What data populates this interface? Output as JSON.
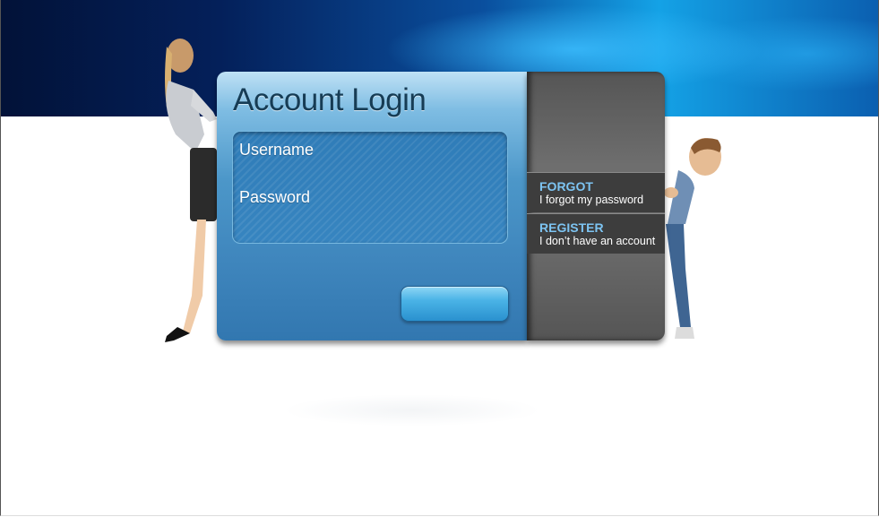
{
  "login": {
    "title": "Account Login",
    "username_label": "Username",
    "password_label": "Password"
  },
  "side_links": {
    "forgot": {
      "title": "FORGOT",
      "subtitle": "I forgot my password"
    },
    "register": {
      "title": "REGISTER",
      "subtitle": "I don’t have an account"
    }
  },
  "colors": {
    "banner_dark": "#021238",
    "banner_light": "#14a2e6",
    "card_blue": "#3f86bd",
    "side_gray": "#6a6a6a",
    "link_blue": "#7dc4f2"
  }
}
